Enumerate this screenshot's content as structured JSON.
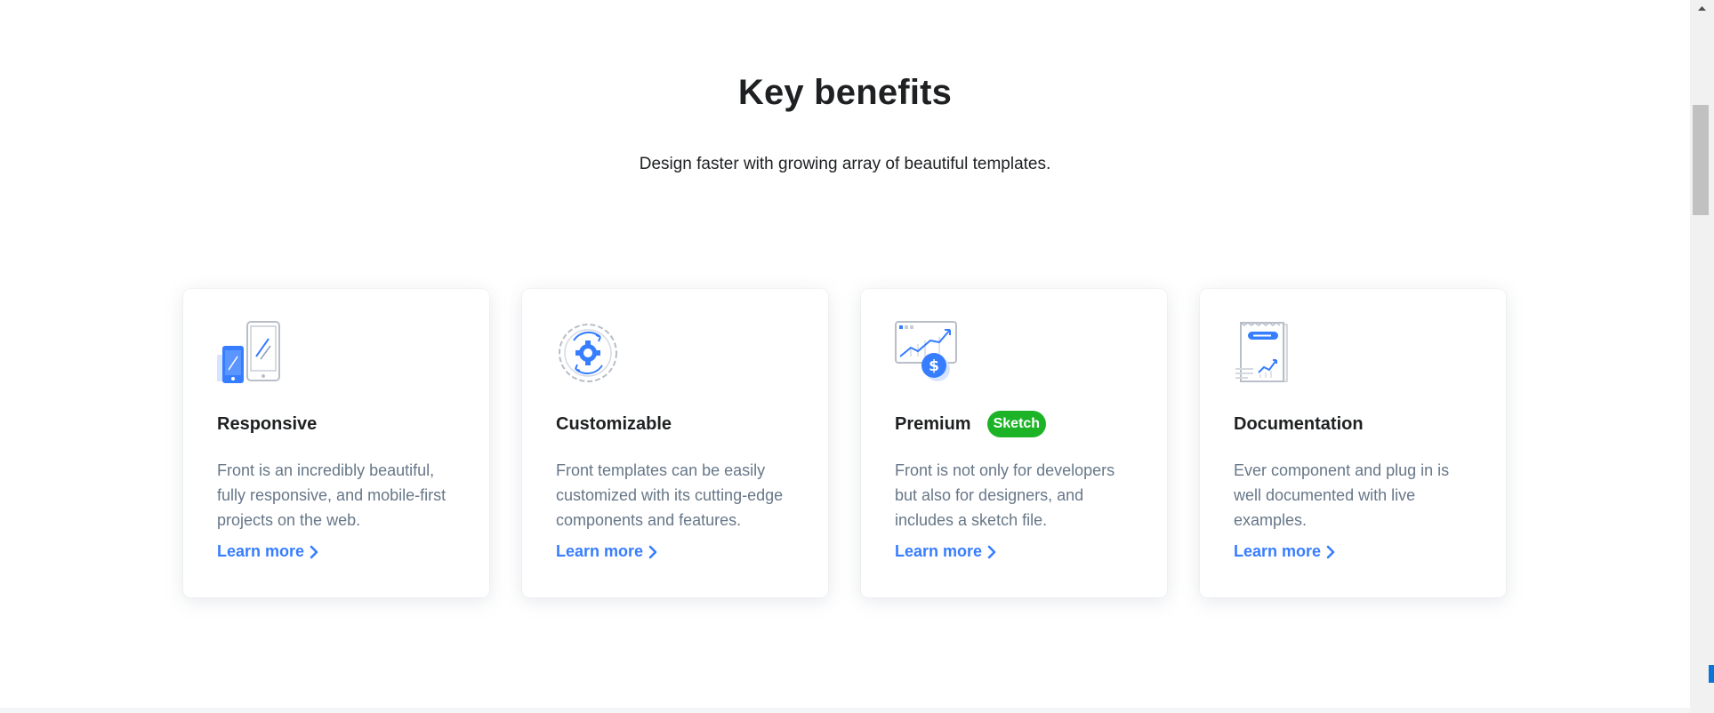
{
  "section": {
    "title": "Key benefits",
    "subtitle": "Design faster with growing array of beautiful templates."
  },
  "cards": [
    {
      "icon": "responsive-devices-icon",
      "title": "Responsive",
      "text": "Front is an incredibly beautiful, fully responsive, and mobile-first projects on the web.",
      "link": "Learn more"
    },
    {
      "icon": "gear-sync-icon",
      "title": "Customizable",
      "text": "Front templates can be easily customized with its cutting-edge components and features.",
      "link": "Learn more"
    },
    {
      "icon": "chart-dollar-icon",
      "title": "Premium",
      "badge": "Sketch",
      "text": "Front is not only for developers but also for designers, and includes a sketch file.",
      "link": "Learn more"
    },
    {
      "icon": "document-chart-icon",
      "title": "Documentation",
      "text": "Ever component and plug in is well documented with live examples.",
      "link": "Learn more"
    }
  ],
  "colors": {
    "primary": "#377dff",
    "badge_green": "#1db326",
    "body_text": "#677788",
    "heading": "#1e2022"
  }
}
